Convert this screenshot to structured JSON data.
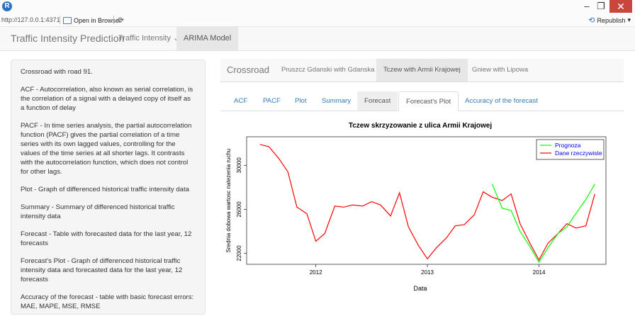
{
  "window": {
    "url": "http://127.0.0.1:4371",
    "open_in_browser": "Open in Browser",
    "republish": "Republish",
    "minimize": "–",
    "maximize": "❐",
    "close": "✕"
  },
  "navbar": {
    "brand": "Traffic Intensity Prediction",
    "items": [
      {
        "label": "Traffic Intensity ⌄"
      },
      {
        "label": "ARIMA Model"
      }
    ]
  },
  "sidebar": {
    "paragraphs": [
      "Crossroad with road 91.",
      "ACF - Autocorrelation, also known as serial correlation, is the correlation of a signal with a delayed copy of itself as a function of delay",
      "PACF - In time series analysis, the partial autocorrelation function (PACF) gives the partial correlation of a time series with its own lagged values, controlling for the values of the time series at all shorter lags. It contrasts with the autocorrelation function, which does not control for other lags.",
      "Plot - Graph of differenced historical traffic intensity data",
      "Summary - Summary of differenced historical traffic intensity data",
      "Forecast - Table with forecasted data for the last year, 12 forecasts",
      "Forecast's Plot - Graph of differenced historical traffic intensity data and forecasted data for the last year, 12 forecasts",
      "Accuracy of the forecast - table with basic forecast errors: MAE, MAPE, MSE, RMSE"
    ]
  },
  "crossroad": {
    "title": "Crossroad",
    "tabs": [
      "Pruszcz Gdanski with Gdanska",
      "Tczew with Armii Krajowej",
      "Gniew with Lipowa"
    ]
  },
  "subtabs": [
    "ACF",
    "PACF",
    "Plot",
    "Summary",
    "Forecast",
    "Forecast's Plot",
    "Accuracy of the forecast"
  ],
  "chart_data": {
    "type": "line",
    "title": "Tczew skrzyzowanie z ulica Armii Krajowej",
    "xlabel": "Data",
    "ylabel": "Srednia dobowa wartosc natezenia ruchu",
    "xlim": [
      2011.38,
      2014.6
    ],
    "ylim": [
      21000,
      32600
    ],
    "xticks": [
      2012,
      2013,
      2014
    ],
    "yticks": [
      22000,
      26000,
      30000
    ],
    "legend_position": "top-right",
    "series": [
      {
        "name": "Prognoza",
        "color": "#00ff00",
        "x": [
          2013.58,
          2013.67,
          2013.75,
          2013.83,
          2013.92,
          2014.0,
          2014.08,
          2014.17,
          2014.25,
          2014.33,
          2014.42,
          2014.5
        ],
        "y": [
          28300,
          26100,
          25900,
          24000,
          22600,
          21200,
          22500,
          23800,
          24400,
          25600,
          26900,
          28300
        ]
      },
      {
        "name": "Dane rzeczywiste",
        "color": "#ff0000",
        "x": [
          2011.5,
          2011.58,
          2011.67,
          2011.75,
          2011.83,
          2011.92,
          2012.0,
          2012.08,
          2012.17,
          2012.25,
          2012.33,
          2012.42,
          2012.5,
          2012.58,
          2012.67,
          2012.75,
          2012.83,
          2012.92,
          2013.0,
          2013.08,
          2013.17,
          2013.25,
          2013.33,
          2013.42,
          2013.5,
          2013.58,
          2013.67,
          2013.75,
          2013.83,
          2013.92,
          2014.0,
          2014.08,
          2014.17,
          2014.25,
          2014.33,
          2014.42,
          2014.5
        ],
        "y": [
          31900,
          31700,
          30600,
          29400,
          26200,
          25600,
          23100,
          23800,
          26300,
          26200,
          26400,
          26300,
          26700,
          26400,
          25400,
          27500,
          24400,
          22700,
          21500,
          22500,
          23400,
          24500,
          24600,
          25500,
          27600,
          27100,
          26800,
          27400,
          24700,
          22900,
          21400,
          22900,
          23800,
          24700,
          24300,
          24500,
          27400
        ]
      }
    ]
  }
}
